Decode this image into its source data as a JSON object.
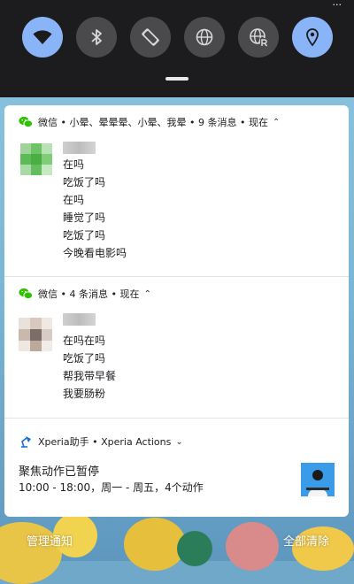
{
  "status": {
    "fragment": "..."
  },
  "quick_settings": {
    "tiles": [
      {
        "icon": "wifi-icon",
        "on": true
      },
      {
        "icon": "bluetooth-icon",
        "on": false
      },
      {
        "icon": "auto-rotate-icon",
        "on": false
      },
      {
        "icon": "globe-icon",
        "on": false
      },
      {
        "icon": "globe-roaming-icon",
        "on": false
      },
      {
        "icon": "location-icon",
        "on": true
      }
    ]
  },
  "notifications": [
    {
      "app_icon": "wechat-icon",
      "header": "微信 • 小晕、晕晕晕、小晕、我晕 • 9 条消息 • 现在",
      "messages": [
        "在吗",
        "吃饭了吗",
        "在吗",
        "睡觉了吗",
        "吃饭了吗",
        "今晚看电影吗"
      ]
    },
    {
      "app_icon": "wechat-icon",
      "header": "微信 • 4 条消息 • 现在",
      "messages": [
        "在吗在吗",
        "吃饭了吗",
        "帮我带早餐",
        "我要肠粉"
      ]
    },
    {
      "app_icon": "xperia-lamp-icon",
      "header": "Xperia助手 • Xperia Actions",
      "title": "聚焦动作已暂停",
      "subtitle": "10:00 - 18:00，周一 - 周五，4个动作"
    }
  ],
  "footer": {
    "manage": "管理通知",
    "clear_all": "全部清除"
  },
  "colors": {
    "shade": "#1c1c1e",
    "tile_on": "#8ab4f8",
    "tile_off": "#4a4a4d",
    "wechat_green": "#2dc100"
  }
}
